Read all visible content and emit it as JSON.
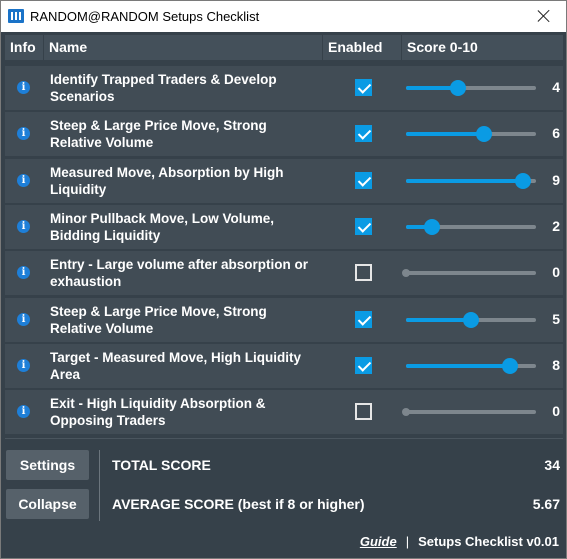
{
  "window": {
    "title": "RANDOM@RANDOM Setups Checklist"
  },
  "headers": {
    "info": "Info",
    "name": "Name",
    "enabled": "Enabled",
    "score": "Score 0-10"
  },
  "colors": {
    "accent": "#0a9be4",
    "background": "#36414a",
    "row": "#414c55",
    "header": "#44505a",
    "info_icon": "#1e7fd8"
  },
  "rows": [
    {
      "name": "Identify Trapped Traders & Develop Scenarios",
      "enabled": true,
      "score": "4",
      "level": 4,
      "info_icon": "info-icon"
    },
    {
      "name": "Steep & Large Price Move, Strong Relative Volume",
      "enabled": true,
      "score": "6",
      "level": 6,
      "info_icon": "info-icon"
    },
    {
      "name": "Measured Move, Absorption by High Liquidity",
      "enabled": true,
      "score": "9",
      "level": 9,
      "info_icon": "info-icon"
    },
    {
      "name": "Minor Pullback Move, Low Volume, Bidding Liquidity",
      "enabled": true,
      "score": "2",
      "level": 2,
      "info_icon": "info-icon"
    },
    {
      "name": "Entry - Large volume after absorption or exhaustion",
      "enabled": false,
      "score": "0",
      "level": 0,
      "info_icon": "info-icon"
    },
    {
      "name": "Steep & Large Price Move, Strong Relative Volume",
      "enabled": true,
      "score": "5",
      "level": 5,
      "info_icon": "info-icon"
    },
    {
      "name": "Target - Measured Move, High Liquidity Area",
      "enabled": true,
      "score": "8",
      "level": 8,
      "info_icon": "info-icon"
    },
    {
      "name": "Exit - High Liquidity Absorption & Opposing Traders",
      "enabled": false,
      "score": "0",
      "level": 0,
      "info_icon": "info-icon"
    }
  ],
  "buttons": {
    "settings": "Settings",
    "collapse": "Collapse"
  },
  "summary": {
    "total_label": "TOTAL SCORE",
    "total_value": "34",
    "average_label": "AVERAGE SCORE (best if 8 or higher)",
    "average_value": "5.67"
  },
  "footer": {
    "guide": "Guide",
    "separator": "|",
    "version": "Setups Checklist v0.01"
  }
}
